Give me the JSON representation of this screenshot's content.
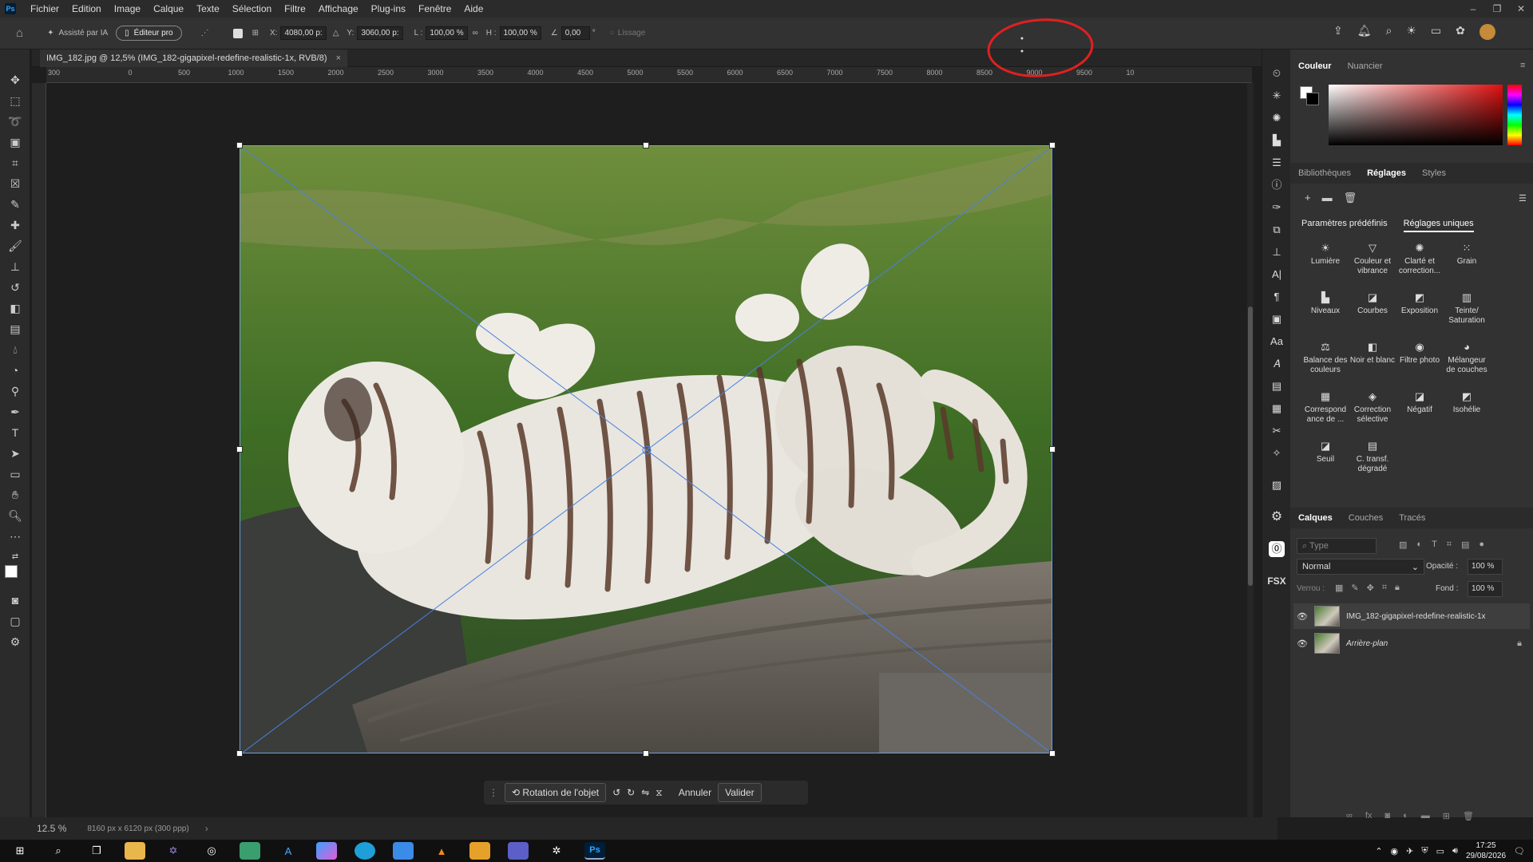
{
  "menu": {
    "app_logo": "Ps",
    "items": [
      "Fichier",
      "Edition",
      "Image",
      "Calque",
      "Texte",
      "Sélection",
      "Filtre",
      "Affichage",
      "Plug-ins",
      "Fenêtre",
      "Aide"
    ]
  },
  "options": {
    "ai_assist": "Assisté par IA",
    "pro_editor": "Éditeur pro",
    "x_label": "X:",
    "x_value": "4080,00 p:",
    "y_label": "Y:",
    "y_value": "3060,00 p:",
    "w_label": "L :",
    "w_value": "100,00 %",
    "h_label": "H :",
    "h_value": "100,00 %",
    "angle_value": "0,00",
    "angle_unit": "°",
    "smoothing": "Lissage"
  },
  "document": {
    "tab_title": "IMG_182.jpg @ 12,5% (IMG_182-gigapixel-redefine-realistic-1x, RVB/8)",
    "close": "×",
    "zoom": "12.5 %",
    "size_info": "8160 px x 6120 px (300 ppp)"
  },
  "ruler": {
    "h_ticks": [
      "300",
      "0",
      "500",
      "1000",
      "1500",
      "2000",
      "2500",
      "3000",
      "3500",
      "4000",
      "4500",
      "5000",
      "5500",
      "6000",
      "6500",
      "7000",
      "7500",
      "8000",
      "8500",
      "9000",
      "9500",
      "10"
    ]
  },
  "transform_bar": {
    "rotate_label": "Rotation de l'objet",
    "cancel": "Annuler",
    "commit": "Valider"
  },
  "color_panel": {
    "tabs": [
      "Couleur",
      "Nuancier"
    ]
  },
  "adjust_panel": {
    "tabs": [
      "Bibliothèques",
      "Réglages",
      "Styles"
    ],
    "subtabs": [
      "Paramètres prédéfinis",
      "Réglages uniques"
    ],
    "items": [
      {
        "label": "Lumière",
        "icon": "sun-icon"
      },
      {
        "label": "Couleur et vibrance",
        "icon": "triangle-icon"
      },
      {
        "label": "Clarté et correction...",
        "icon": "sparkle-icon"
      },
      {
        "label": "Grain",
        "icon": "grain-icon"
      },
      {
        "label": "Niveaux",
        "icon": "levels-icon"
      },
      {
        "label": "Courbes",
        "icon": "curves-icon"
      },
      {
        "label": "Exposition",
        "icon": "exposure-icon"
      },
      {
        "label": "Teinte/ Saturation",
        "icon": "hue-icon"
      },
      {
        "label": "Balance des couleurs",
        "icon": "balance-icon"
      },
      {
        "label": "Noir et blanc",
        "icon": "bw-icon"
      },
      {
        "label": "Filtre photo",
        "icon": "camera-icon"
      },
      {
        "label": "Mélangeur de couches",
        "icon": "mixer-icon"
      },
      {
        "label": "Correspond ance de ...",
        "icon": "lookup-icon"
      },
      {
        "label": "Correction sélective",
        "icon": "selective-icon"
      },
      {
        "label": "Négatif",
        "icon": "invert-icon"
      },
      {
        "label": "Isohélie",
        "icon": "posterize-icon"
      },
      {
        "label": "Seuil",
        "icon": "threshold-icon"
      },
      {
        "label": "C. transf. dégradé",
        "icon": "gradientmap-icon"
      }
    ]
  },
  "layers_panel": {
    "tabs": [
      "Calques",
      "Couches",
      "Tracés"
    ],
    "search_placeholder": "Type",
    "blend_mode": "Normal",
    "opacity_label": "Opacité :",
    "opacity_value": "100 %",
    "lock_label": "Verrou :",
    "fill_label": "Fond :",
    "fill_value": "100 %",
    "layers": [
      {
        "name": "IMG_182-gigapixel-redefine-realistic-1x"
      },
      {
        "name": "Arrière-plan"
      }
    ]
  },
  "iconstrip": {
    "fsx": "FSX"
  },
  "taskbar": {
    "time": "17:25",
    "date": "29/08/2026"
  },
  "colors": {
    "accent": "#31a8ff",
    "bbox": "#6fa0e8",
    "annotation": "#e02020"
  }
}
